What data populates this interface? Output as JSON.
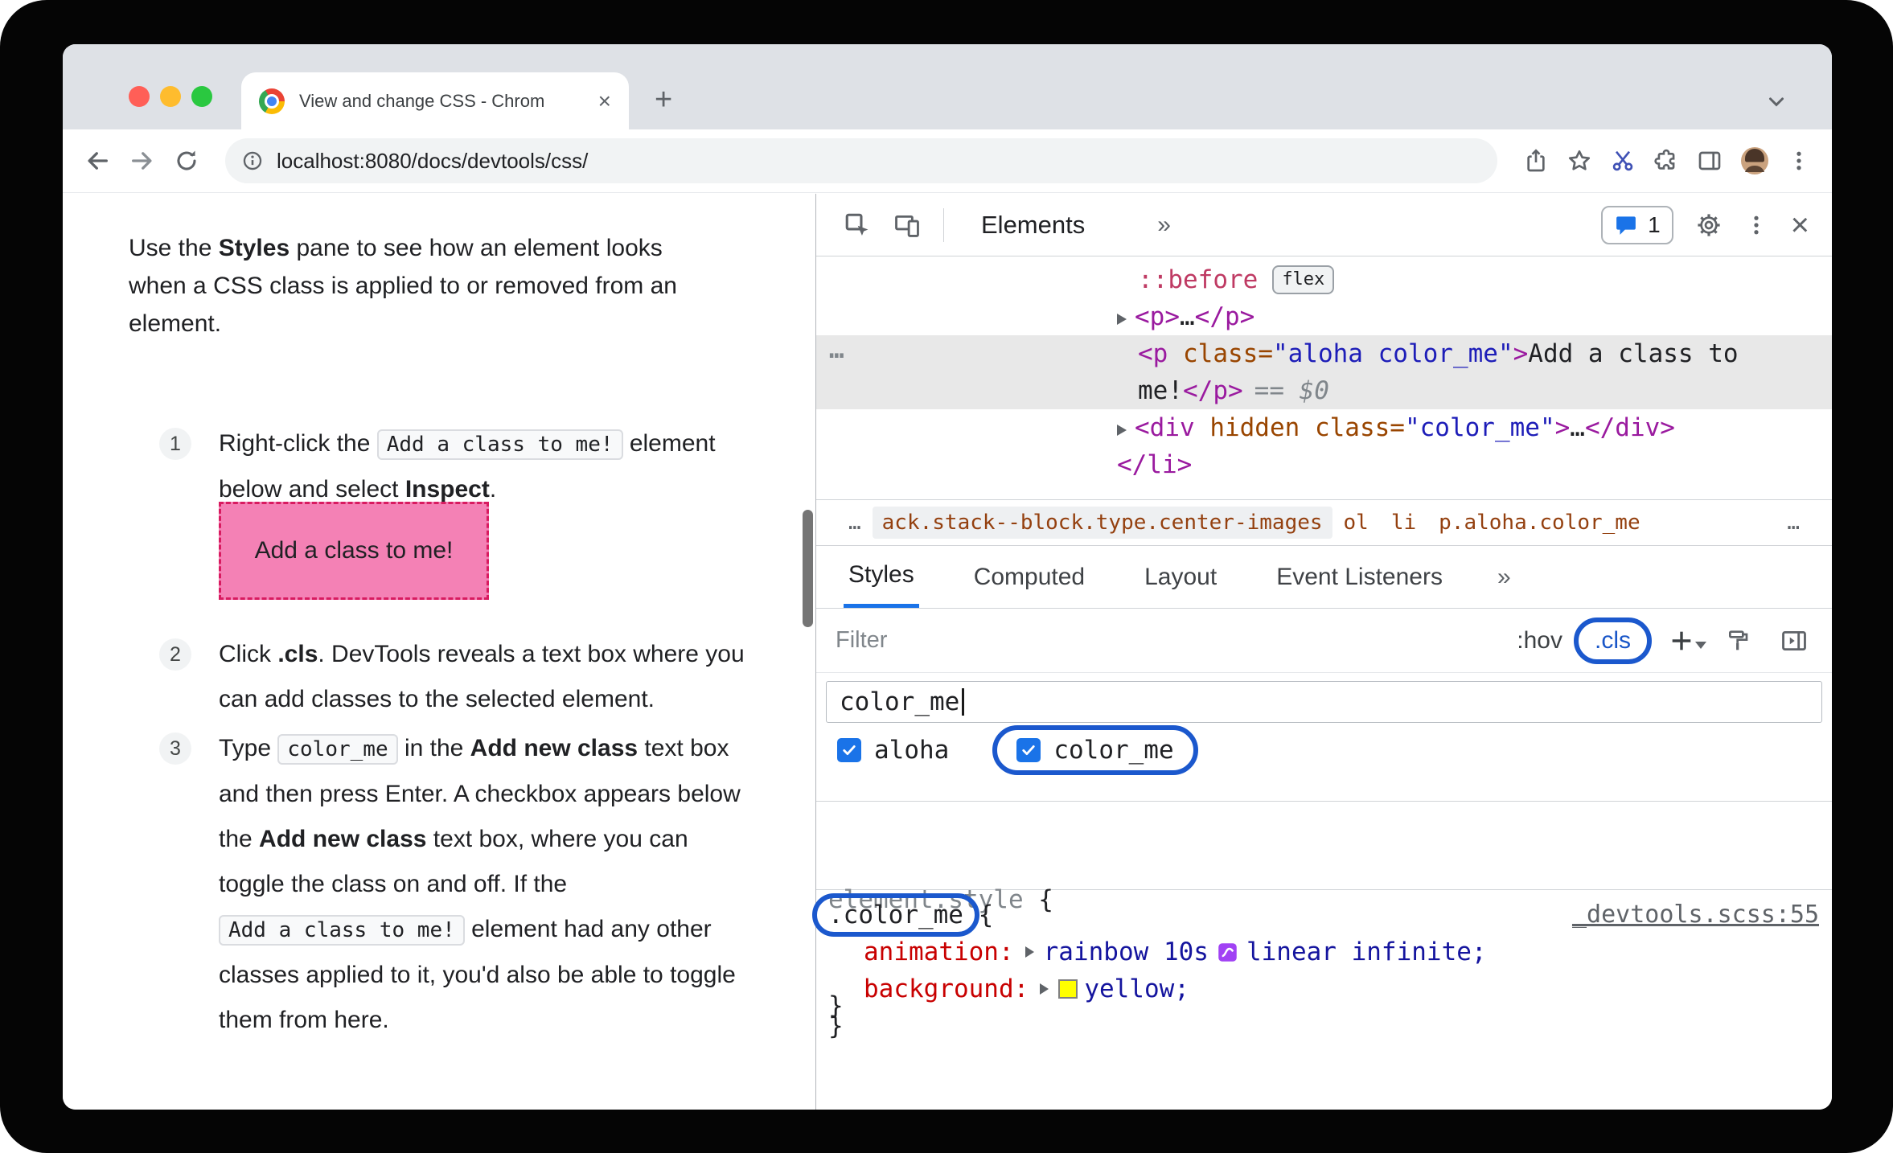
{
  "glyphs": {
    "close": "×",
    "plus": "+",
    "more": "»",
    "ellipsis": "…"
  },
  "colors": {
    "annotation_blue": "#1b58cd",
    "accent_blue": "#1a73e8",
    "demo_box_bg": "#f481b5",
    "demo_box_border": "#d81b60",
    "tag_purple": "#9a1a9f",
    "attr_orange": "#994500",
    "attr_value_blue": "#1d1db8",
    "css_property_red": "#c80000",
    "css_value_navy": "#14149e",
    "swatch_yellow": "#ffff00"
  },
  "browser": {
    "tab_title": "View and change CSS - Chrom",
    "url": "localhost:8080/docs/devtools/css/"
  },
  "doc": {
    "intro": {
      "t1": "Use the ",
      "b1": "Styles",
      "t2": " pane to see how an element looks when a CSS class is applied to or removed from an element."
    },
    "steps": [
      {
        "num": "1",
        "t1": "Right-click the ",
        "code1": "Add a class to me!",
        "t2": " element below and select ",
        "b1": "Inspect",
        "t3": "."
      },
      {
        "num": "2",
        "t1": "Click ",
        "b1": ".cls",
        "t2": ". DevTools reveals a text box where you can add classes to the selected element."
      },
      {
        "num": "3",
        "t1": "Type ",
        "code1": "color_me",
        "t2": " in the ",
        "b1": "Add new class",
        "t3": " text box and then press Enter. A checkbox appears below the ",
        "b2": "Add new class",
        "t4": " text box, where you can toggle the class on and off. If the ",
        "code2": "Add a class to me!",
        "t5": " element had any other classes applied to it, you'd also be able to toggle them from here."
      }
    ],
    "demo_box_label": "Add a class to me!"
  },
  "devtools": {
    "toolbar": {
      "elements_tab": "Elements",
      "issues_count": "1"
    },
    "dom": {
      "pseudo": "::before",
      "flex_badge": "flex",
      "p_row": {
        "open": "<p>",
        "dots": "…",
        "close": "</p>"
      },
      "selected": {
        "tag": "<p",
        "attr": " class",
        "eq": "=",
        "value": "\"aloha color_me\"",
        "gt": ">",
        "text1": "Add a class to",
        "text2": "me!",
        "close": "</p>",
        "marker": "== $0"
      },
      "div_row": {
        "tag": "<div",
        "attr1": " hidden",
        "attr2": " class",
        "eq": "=",
        "value": "\"color_me\"",
        "gt": ">",
        "dots": "…",
        "close": "</div>"
      },
      "li_close": "</li>"
    },
    "breadcrumbs": [
      "…",
      "ack.stack--block.type.center-images",
      "ol",
      "li",
      "p.aloha.color_me",
      "…"
    ],
    "styles": {
      "tabs": [
        "Styles",
        "Computed",
        "Layout",
        "Event Listeners"
      ],
      "filter_placeholder": "Filter",
      "hov_label": ":hov",
      "cls_label": ".cls",
      "class_input": "color_me",
      "checks": [
        {
          "label": "aloha",
          "checked": true
        },
        {
          "label": "color_me",
          "checked": true
        }
      ],
      "element_style": {
        "selector": "element.style",
        "open": " {",
        "close": "}"
      },
      "rule": {
        "selector": ".color_me",
        "open": " {",
        "source_link": "_devtools.scss:55",
        "prop1": "animation:",
        "val1a": "rainbow 10s",
        "val1b": "linear infinite;",
        "prop2": "background:",
        "val2": "yellow;",
        "close": "}"
      }
    }
  }
}
